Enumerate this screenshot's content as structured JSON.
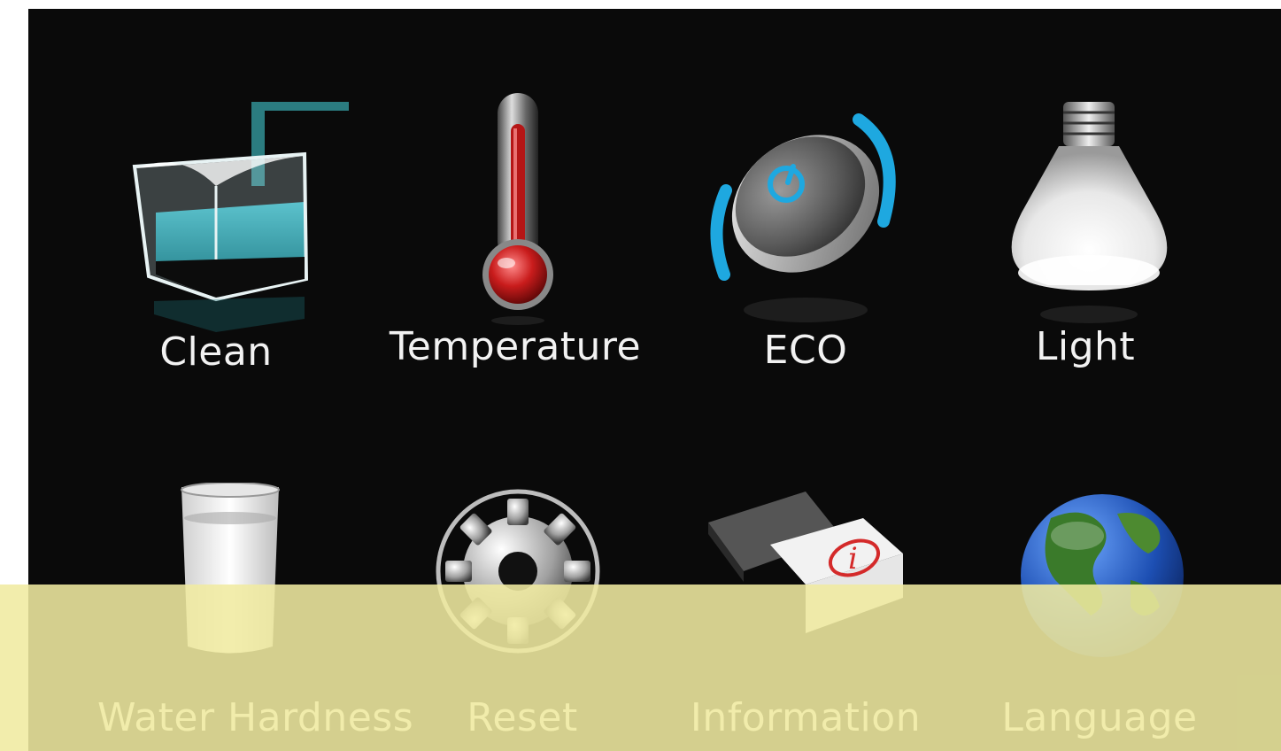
{
  "menu": {
    "row1": [
      {
        "id": "clean",
        "label": "Clean",
        "icon": "beaker-clean-icon"
      },
      {
        "id": "temperature",
        "label": "Temperature",
        "icon": "thermometer-icon"
      },
      {
        "id": "eco",
        "label": "ECO",
        "icon": "eco-power-button-icon"
      },
      {
        "id": "light",
        "label": "Light",
        "icon": "light-bulb-icon"
      }
    ],
    "row2": [
      {
        "id": "water_hardness",
        "label": "Water Hardness",
        "icon": "water-glass-icon"
      },
      {
        "id": "reset",
        "label": "Reset",
        "icon": "gear-icon"
      },
      {
        "id": "information",
        "label": "Information",
        "icon": "information-book-icon"
      },
      {
        "id": "language",
        "label": "Language",
        "icon": "globe-icon"
      }
    ]
  },
  "colors": {
    "background": "#0a0a0a",
    "accent_blue": "#1ea8e0",
    "overlay_yellow": "#f0eba0",
    "label_text": "#f2f2f2"
  }
}
